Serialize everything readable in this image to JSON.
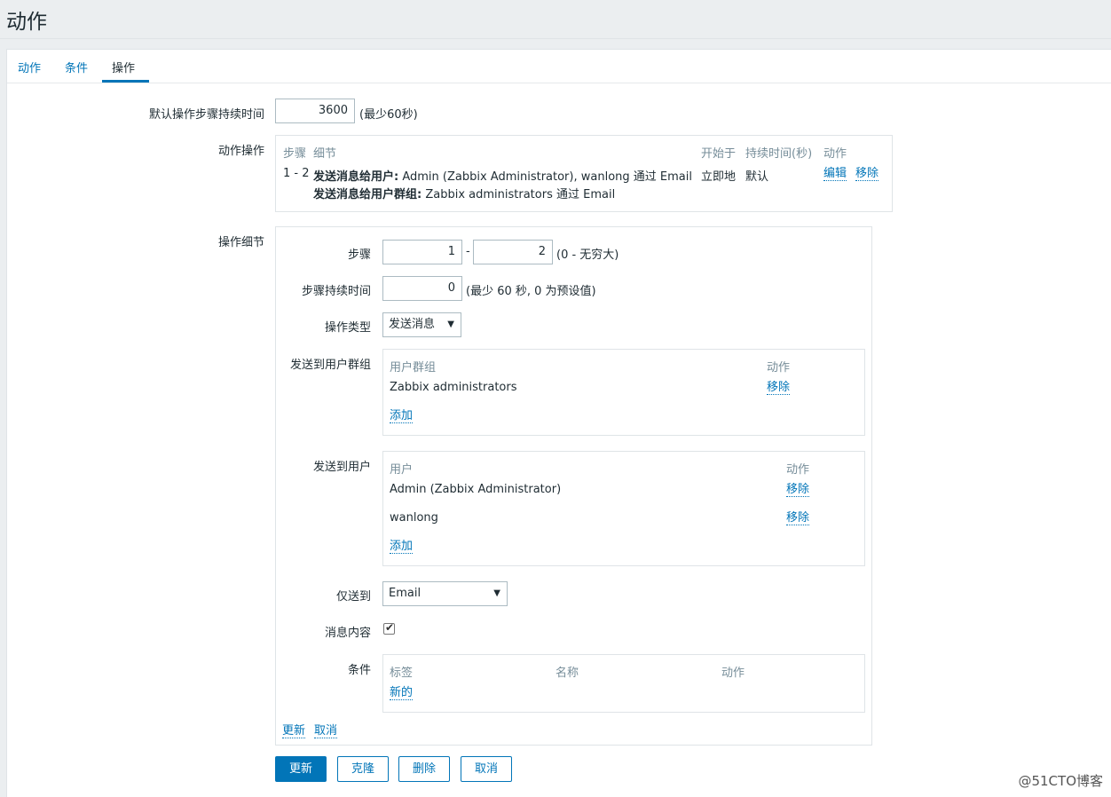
{
  "page": {
    "title": "动作"
  },
  "tabs": [
    {
      "label": "动作"
    },
    {
      "label": "条件"
    },
    {
      "label": "操作"
    }
  ],
  "default_duration": {
    "label": "默认操作步骤持续时间",
    "value": "3600",
    "hint": "(最少60秒)"
  },
  "operations": {
    "label": "动作操作",
    "headers": {
      "steps": "步骤",
      "details": "细节",
      "start": "开始于",
      "duration": "持续时间(秒)",
      "action": "动作"
    },
    "row": {
      "steps": "1 - 2",
      "line1_bold": "发送消息给用户:",
      "line1_rest": " Admin (Zabbix Administrator), wanlong 通过 Email",
      "line2_bold": "发送消息给用户群组:",
      "line2_rest": " Zabbix administrators 通过 Email",
      "start": "立即地",
      "duration": "默认",
      "edit": "编辑",
      "remove": "移除"
    }
  },
  "details": {
    "label": "操作细节",
    "step": {
      "label": "步骤",
      "from": "1",
      "sep": "-",
      "to": "2",
      "hint": "(0 - 无穷大)"
    },
    "step_duration": {
      "label": "步骤持续时间",
      "value": "0",
      "hint": "(最少 60 秒, 0 为预设值)"
    },
    "op_type": {
      "label": "操作类型",
      "value": "发送消息"
    },
    "user_groups": {
      "label": "发送到用户群组",
      "col_name": "用户群组",
      "col_action": "动作",
      "items": [
        {
          "name": "Zabbix administrators",
          "action": "移除"
        }
      ],
      "add": "添加"
    },
    "users": {
      "label": "发送到用户",
      "col_name": "用户",
      "col_action": "动作",
      "items": [
        {
          "name": "Admin (Zabbix Administrator)",
          "action": "移除"
        },
        {
          "name": "wanlong",
          "action": "移除"
        }
      ],
      "add": "添加"
    },
    "send_only": {
      "label": "仅送到",
      "value": "Email"
    },
    "default_message": {
      "label": "消息内容",
      "checked": true
    },
    "conditions": {
      "label": "条件",
      "col_label": "标签",
      "col_name": "名称",
      "col_action": "动作",
      "new": "新的"
    },
    "update_link": "更新",
    "cancel_link": "取消"
  },
  "buttons": {
    "update": "更新",
    "clone": "克隆",
    "delete": "删除",
    "cancel": "取消"
  },
  "watermark": "@51CTO博客",
  "colors": {
    "accent": "#0275b8",
    "text": "#1f2c33",
    "muted": "#768d99",
    "border": "#dfe4e7"
  }
}
